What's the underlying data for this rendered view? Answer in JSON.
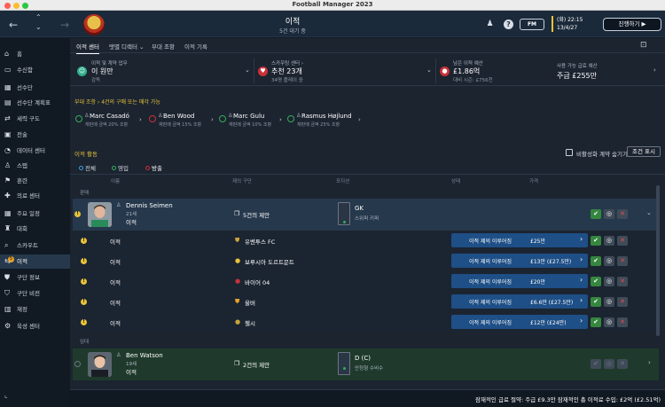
{
  "app": {
    "window_title": "Football Manager 2023"
  },
  "header": {
    "page_title": "이적",
    "page_subtitle": "5건 대기 중",
    "fm_label": "FM",
    "date_line1": "(화) 22:15",
    "date_line2": "13/4/27",
    "continue_label": "진행하기 ▶"
  },
  "sidebar": {
    "items": [
      {
        "label": "홈",
        "icon": "home-icon"
      },
      {
        "label": "수신함",
        "icon": "inbox-icon"
      },
      {
        "label": "선수단",
        "icon": "squad-icon"
      },
      {
        "label": "선수단 계획표",
        "icon": "plan-icon"
      },
      {
        "label": "세력 구도",
        "icon": "dynamics-icon"
      },
      {
        "label": "전술",
        "icon": "tactics-icon"
      },
      {
        "label": "데이터 센터",
        "icon": "data-icon"
      },
      {
        "label": "스탭",
        "icon": "staff-icon"
      },
      {
        "label": "훈련",
        "icon": "training-icon"
      },
      {
        "label": "의료 센터",
        "icon": "medical-icon"
      },
      {
        "label": "주요 일정",
        "icon": "calendar-icon"
      },
      {
        "label": "대회",
        "icon": "trophy-icon"
      },
      {
        "label": "스카우트",
        "icon": "scout-icon"
      },
      {
        "label": "이적",
        "icon": "transfer-icon",
        "badge": "5"
      },
      {
        "label": "구단 정보",
        "icon": "club-info-icon"
      },
      {
        "label": "구단 비전",
        "icon": "vision-icon"
      },
      {
        "label": "재정",
        "icon": "finance-icon"
      },
      {
        "label": "육성 센터",
        "icon": "development-icon"
      }
    ]
  },
  "tabs": [
    {
      "label": "이적 센터"
    },
    {
      "label": "탯별 디렉터 ⌄"
    },
    {
      "label": "부대 조항"
    },
    {
      "label": "이적 기록"
    }
  ],
  "summary": {
    "card1": {
      "label": "이적 및 계약 업무",
      "value": "이 원만",
      "sub": "감독"
    },
    "card2": {
      "label": "스카우팅 센터 ›",
      "value": "추천 23개",
      "sub": "34명 플레이 중"
    },
    "card3": {
      "label": "남은 이적 예산",
      "value": "£1.86억",
      "sub": "대비 시즌: £756천"
    },
    "card4": {
      "label": "사용 가능 급료 예산",
      "value": "주급 £255만"
    }
  },
  "alert": {
    "prefix": "부대 조항",
    "text": "4건의 구매 또는 매각 가능"
  },
  "targets": [
    {
      "name": "Marc Casadó",
      "sub": "재판매 금액 20% 조항"
    },
    {
      "name": "Ben Wood",
      "sub": "재판매 금액 15% 조항"
    },
    {
      "name": "Marc Gulu",
      "sub": "재판매 금액 10% 조항"
    },
    {
      "name": "Rasmus Højlund",
      "sub": "재판매 금액 25% 조항"
    }
  ],
  "activity": {
    "title": "이적 활동",
    "hide_expired_label": "비활성화 계약 숨기기",
    "filter_button": "조건 표시",
    "subtabs": [
      "전체",
      "영입",
      "방출"
    ],
    "columns": {
      "name": "이름",
      "offers": "제의 구단",
      "position": "포지션",
      "status": "상태",
      "fee": "가격"
    },
    "groups": {
      "sale": "판매",
      "loan": "임대"
    }
  },
  "players": [
    {
      "name": "Dennis Seimen",
      "age": "21세",
      "status": "이적",
      "offers": "5건의 제안",
      "position": "GK",
      "role": "스위퍼 키퍼"
    },
    {
      "name": "Ben Watson",
      "age": "19세",
      "status": "이적",
      "offers": "2건의 제안",
      "position": "D (C)",
      "role": "안정형 수비수"
    }
  ],
  "offers": [
    {
      "type": "이적",
      "club": "유벤투스 FC",
      "status": "이적 제의 이루어짐",
      "fee": "£25만"
    },
    {
      "type": "이적",
      "club": "보루시아 도르트문트",
      "status": "이적 제의 이루어짐",
      "fee": "£13만 (£27.5만)"
    },
    {
      "type": "이적",
      "club": "바이어 04",
      "status": "이적 제의 이루어짐",
      "fee": "£20만"
    },
    {
      "type": "이적",
      "club": "울버",
      "status": "이적 제의 이루어짐",
      "fee": "£6.6만 (£27.5만)"
    },
    {
      "type": "이적",
      "club": "첼시",
      "status": "이적 제의 이루어짐",
      "fee": "£12만 (£24만)"
    }
  ],
  "footer": {
    "text": "잠재적인 급료 절약: 주급 £9.3만 잠재적인 총 이적료 수입: £2억 (£2.51억)"
  },
  "colors": {
    "accent": "#e8c33a",
    "status_blue": "#1e4f86",
    "accept_green": "#35863f",
    "reject_red": "#e05050",
    "panel_dark": "#1b2a3a"
  }
}
